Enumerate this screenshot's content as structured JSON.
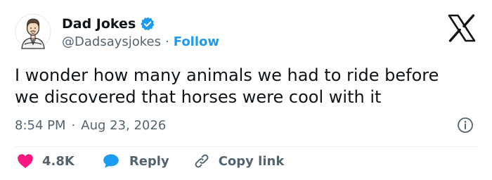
{
  "author": {
    "display_name": "Dad Jokes",
    "handle": "@Dadsaysjokes",
    "separator": "·",
    "follow_label": "Follow",
    "avatar_icon": "cartoon-dad-avatar-icon",
    "verified_icon": "verified-badge-icon",
    "verified_color": "#1d9bf0"
  },
  "platform": {
    "logo_icon": "x-logo-icon"
  },
  "tweet": {
    "text": "I wonder how many animals we had to ride before\nwe discovered that horses were cool with it",
    "time": "8:54 PM",
    "separator": "·",
    "date": "Aug 23, 2026",
    "info_icon": "info-icon"
  },
  "actions": {
    "like_count": "4.8K",
    "like_icon": "heart-icon",
    "like_color": "#f91880",
    "reply_label": "Reply",
    "reply_icon": "speech-bubble-icon",
    "reply_color": "#1d9bf0",
    "copy_label": "Copy link",
    "copy_icon": "link-icon"
  },
  "colors": {
    "text_primary": "#0f1419",
    "text_secondary": "#536471",
    "accent": "#1d9bf0",
    "divider": "#eff3f4"
  }
}
